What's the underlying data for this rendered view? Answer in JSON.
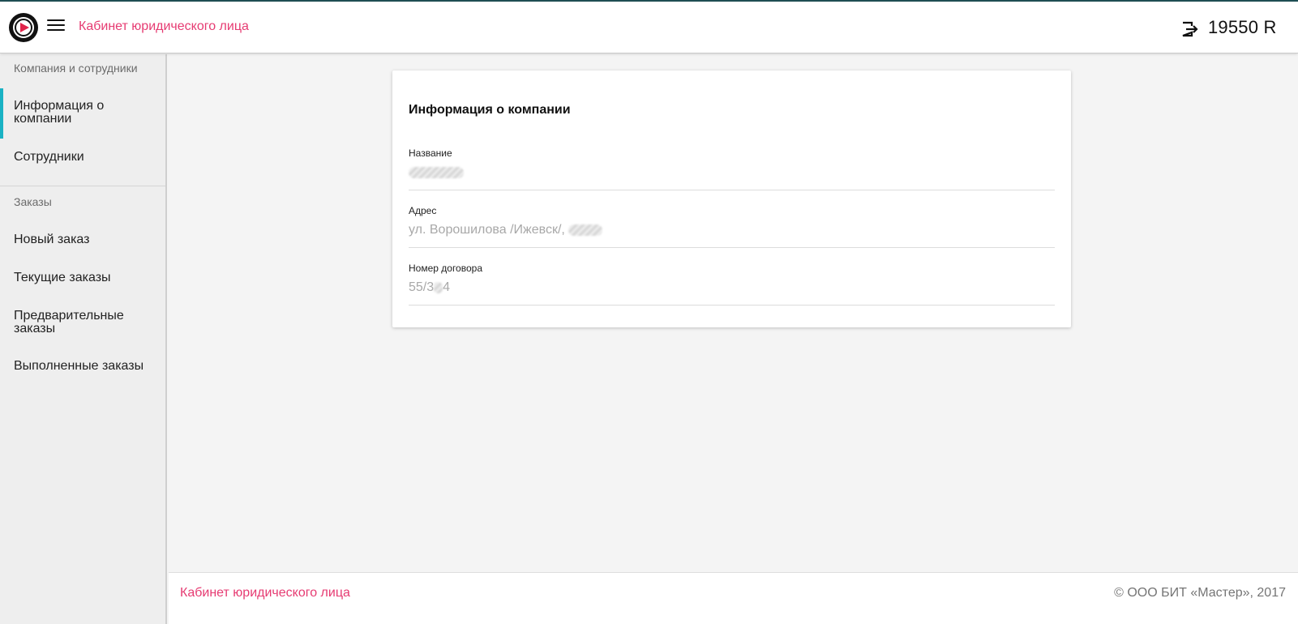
{
  "header": {
    "title": "Кабинет юридического лица",
    "balance": "19550 R",
    "logo_icon": "play-circle-logo",
    "menu_icon": "hamburger-menu-icon",
    "logout_icon": "exit-arrow-icon"
  },
  "sidebar": {
    "sections": [
      {
        "title": "Компания и сотрудники",
        "items": [
          {
            "label": "Информация о компании",
            "active": true
          },
          {
            "label": "Сотрудники"
          }
        ]
      },
      {
        "title": "Заказы",
        "items": [
          {
            "label": "Новый заказ"
          },
          {
            "label": "Текущие заказы"
          },
          {
            "label": "Предварительные заказы"
          },
          {
            "label": "Выполненные заказы"
          }
        ]
      }
    ]
  },
  "card": {
    "title": "Информация о компании",
    "fields": [
      {
        "label": "Название",
        "value": ""
      },
      {
        "label": "Адрес",
        "value": "ул. Ворошилова /Ижевск/,"
      },
      {
        "label": "Номер договора",
        "value_start": "55/3",
        "value_end": "4"
      }
    ]
  },
  "footer": {
    "link": "Кабинет юридического лица",
    "copyright": "© ООО БИТ «Мастер», 2017"
  },
  "colors": {
    "accent_pink": "#e63b72",
    "active_indicator": "#1ab2c4",
    "top_line": "#1f4f55"
  }
}
